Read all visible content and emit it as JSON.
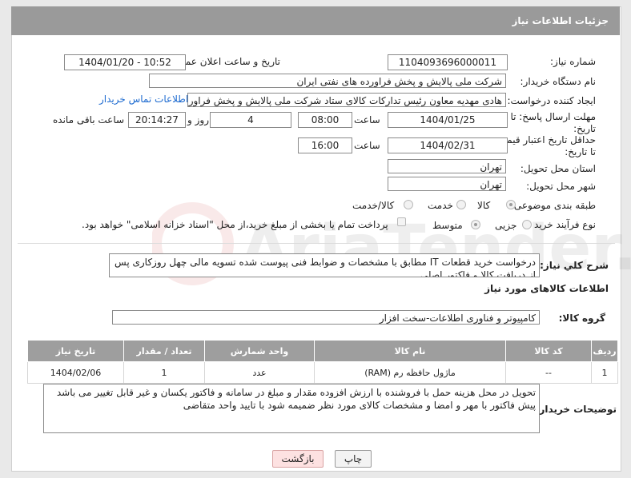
{
  "header": {
    "title": "جزئیات اطلاعات نیاز"
  },
  "form": {
    "need_number_label": "شماره نیاز:",
    "need_number": "1104093696000011",
    "announce_label": "تاریخ و ساعت اعلان عمومی:",
    "announce_value": "1404/01/20 - 10:52",
    "buyer_org_label": "نام دستگاه خریدار:",
    "buyer_org": "شرکت ملی پالایش و پخش فراورده های نفتی ایران",
    "requester_label": "ایجاد کننده درخواست:",
    "requester": "هادی مهدیه معاون رئیس تدارکات کالای ستاد شرکت ملی پالایش و پخش فراورده",
    "contact_link": "اطلاعات تماس خریدار",
    "deadline_label": "مهلت ارسال پاسخ: تا تاریخ:",
    "deadline_date": "1404/01/25",
    "time_label": "ساعت",
    "deadline_time": "08:00",
    "days_value": "4",
    "day_label": "روز و",
    "remaining_time": "20:14:27",
    "remaining_label": "ساعت باقی مانده",
    "price_valid_label": "حداقل تاریخ اعتبار قیمت: تا تاریخ:",
    "price_valid_date": "1404/02/31",
    "price_valid_time": "16:00",
    "province_label": "استان محل تحویل:",
    "province": "تهران",
    "city_label": "شهر محل تحویل:",
    "city": "تهران",
    "category_label": "طبقه بندی موضوعی:",
    "category_options": [
      "کالا",
      "خدمت",
      "کالا/خدمت"
    ],
    "process_label": "نوع فرآیند خرید :",
    "process_options": [
      "جزیی",
      "متوسط"
    ],
    "payment_note": "پرداخت تمام یا بخشی از مبلغ خرید،از محل \"اسناد خزانه اسلامی\" خواهد بود.",
    "description_label": "شرح کلي نياز:",
    "description": "درخواست خرید قطعات IT  مطابق با مشخصات و ضوابط فنی پیوست شده  تسویه مالی چهل روزکاری پس از دریافت کالا و فاکتور اصلی"
  },
  "goods": {
    "section_title": "اطلاعات کالاهای مورد نياز",
    "group_label": "گروه کالا:",
    "group_value": "کامپیوتر و فناوری اطلاعات-سخت افزار",
    "columns": [
      "ردیف",
      "کد کالا",
      "نام کالا",
      "واحد شمارش",
      "تعداد / مقدار",
      "تاریخ نیاز"
    ],
    "rows": [
      {
        "row": "1",
        "code": "--",
        "name": "ماژول حافظه رم (RAM)",
        "unit": "عدد",
        "qty": "1",
        "date": "1404/02/06"
      }
    ]
  },
  "buyer_notes": {
    "label": "توضیحات خریدار:",
    "text": "تحویل در محل هزینه حمل با فروشنده با ارزش افزوده مقدار و مبلغ در سامانه و فاکتور یکسان و غیر قابل تغییر می باشد پیش فاکتور با مهر و امضا و مشخصات کالای مورد نظر ضمیمه شود با تایید واحد متقاضی"
  },
  "buttons": {
    "print": "چاپ",
    "back": "بازگشت"
  },
  "watermark": "AriaTender.net"
}
